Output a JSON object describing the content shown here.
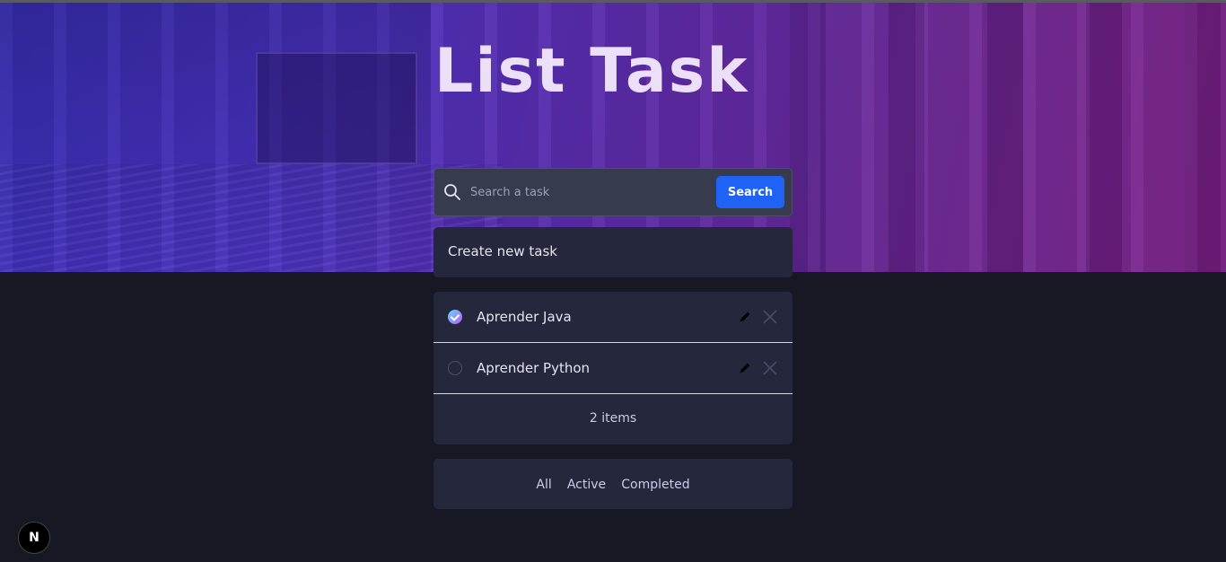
{
  "title": "List Task",
  "search": {
    "placeholder": "Search a task",
    "button_label": "Search",
    "icon": "search-icon"
  },
  "create": {
    "label": "Create new task"
  },
  "tasks": [
    {
      "label": "Aprender Java",
      "completed": true
    },
    {
      "label": "Aprender Python",
      "completed": false
    }
  ],
  "count_label": "2 items",
  "filters": [
    "All",
    "Active",
    "Completed"
  ],
  "badge": {
    "letter": "N"
  },
  "colors": {
    "accent": "#1e62f6",
    "background": "#181824",
    "card": "#25273c",
    "check_gradient_start": "#57ddff",
    "check_gradient_end": "#c058f3"
  }
}
